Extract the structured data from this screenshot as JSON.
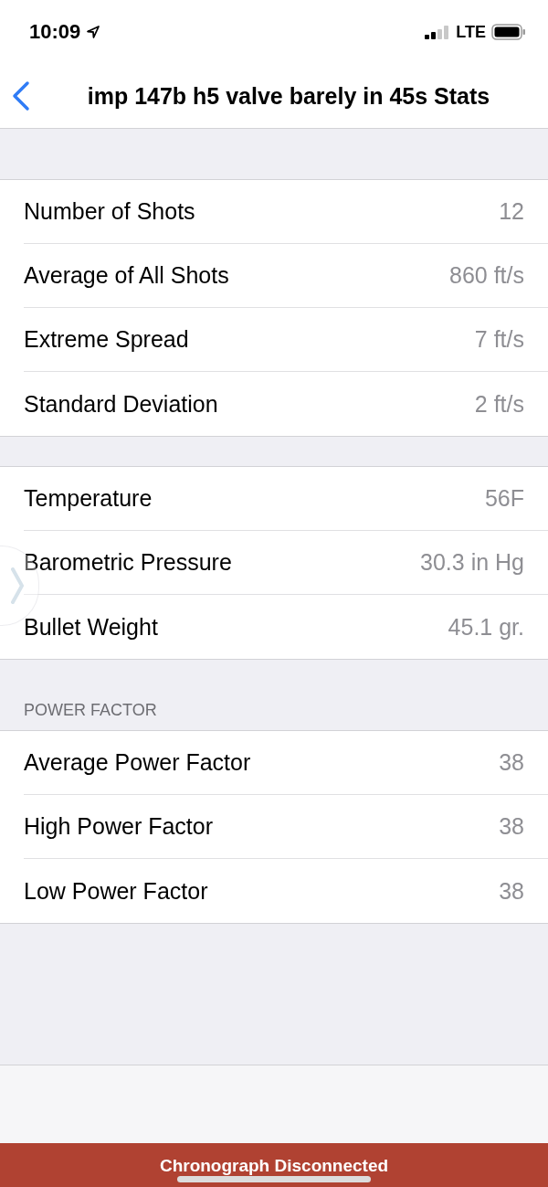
{
  "status_bar": {
    "time": "10:09",
    "network": "LTE"
  },
  "nav": {
    "title": "imp 147b h5 valve barely in 45s Stats"
  },
  "sections": [
    {
      "rows": [
        {
          "label": "Number of Shots",
          "value": "12"
        },
        {
          "label": "Average of All Shots",
          "value": "860 ft/s"
        },
        {
          "label": "Extreme Spread",
          "value": "7 ft/s"
        },
        {
          "label": "Standard Deviation",
          "value": "2 ft/s"
        }
      ]
    },
    {
      "rows": [
        {
          "label": "Temperature",
          "value": "56F"
        },
        {
          "label": "Barometric Pressure",
          "value": "30.3 in Hg"
        },
        {
          "label": "Bullet Weight",
          "value": "45.1 gr."
        }
      ]
    },
    {
      "header": "POWER FACTOR",
      "rows": [
        {
          "label": "Average Power Factor",
          "value": "38"
        },
        {
          "label": "High Power Factor",
          "value": "38"
        },
        {
          "label": "Low Power Factor",
          "value": "38"
        }
      ]
    }
  ],
  "banner": {
    "text": "Chronograph Disconnected"
  }
}
